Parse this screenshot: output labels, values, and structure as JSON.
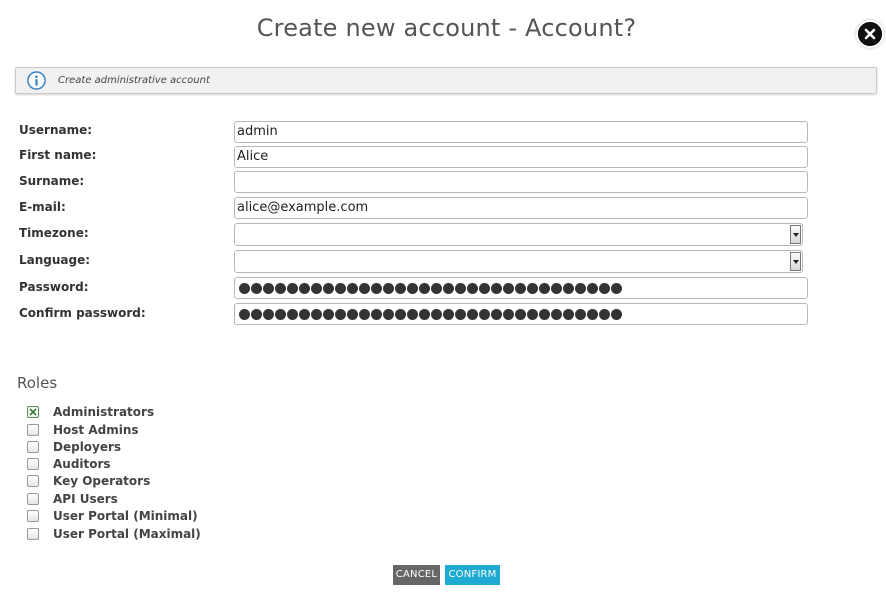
{
  "dialog": {
    "title": "Create new account - Account?"
  },
  "info": {
    "text": "Create administrative account",
    "icon": "info-icon"
  },
  "form": {
    "username_label": "Username:",
    "username_value": "admin",
    "firstname_label": "First name:",
    "firstname_value": "Alice",
    "surname_label": "Surname:",
    "surname_value": "",
    "email_label": "E-mail:",
    "email_value": "alice@example.com",
    "timezone_label": "Timezone:",
    "timezone_value": "",
    "language_label": "Language:",
    "language_value": "",
    "password_label": "Password:",
    "password_mask_count": 32,
    "confirm_password_label": "Confirm password:",
    "confirm_password_mask_count": 32
  },
  "roles": {
    "title": "Roles",
    "items": [
      {
        "label": "Administrators",
        "checked": true
      },
      {
        "label": "Host Admins",
        "checked": false
      },
      {
        "label": "Deployers",
        "checked": false
      },
      {
        "label": "Auditors",
        "checked": false
      },
      {
        "label": "Key Operators",
        "checked": false
      },
      {
        "label": "API Users",
        "checked": false
      },
      {
        "label": "User Portal (Minimal)",
        "checked": false
      },
      {
        "label": "User Portal (Maximal)",
        "checked": false
      }
    ]
  },
  "buttons": {
    "cancel": "CANCEL",
    "confirm": "CONFIRM"
  },
  "colors": {
    "confirm": "#1eaad1",
    "cancel": "#666666",
    "info_icon": "#3b86c6"
  }
}
